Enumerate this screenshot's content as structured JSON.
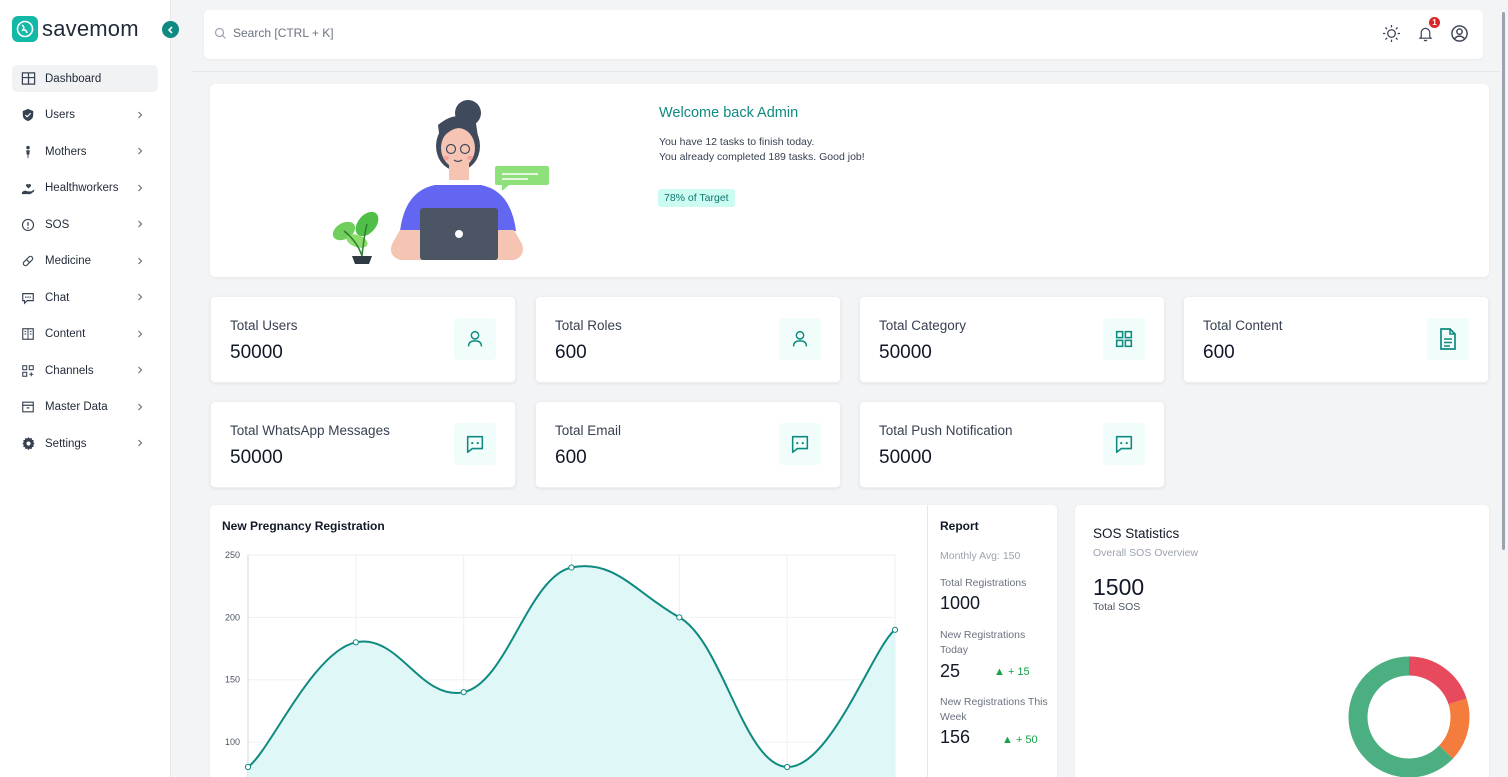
{
  "brand": {
    "name": "savemom"
  },
  "sidebar": {
    "items": [
      {
        "label": "Dashboard",
        "icon": "dashboard-icon"
      },
      {
        "label": "Users",
        "icon": "shield-icon"
      },
      {
        "label": "Mothers",
        "icon": "person-icon"
      },
      {
        "label": "Healthworkers",
        "icon": "hand-heart-icon"
      },
      {
        "label": "SOS",
        "icon": "alert-icon"
      },
      {
        "label": "Medicine",
        "icon": "pill-icon"
      },
      {
        "label": "Chat",
        "icon": "chat-icon"
      },
      {
        "label": "Content",
        "icon": "book-icon"
      },
      {
        "label": "Channels",
        "icon": "apps-add-icon"
      },
      {
        "label": "Master Data",
        "icon": "archive-icon"
      },
      {
        "label": "Settings",
        "icon": "gear-icon"
      }
    ]
  },
  "topbar": {
    "search_placeholder": "Search [CTRL + K]",
    "notification_count": "1"
  },
  "welcome": {
    "title": "Welcome back Admin",
    "line1": "You have 12 tasks to finish today.",
    "line2": "You already completed 189 tasks. Good job!",
    "target": "78% of Target"
  },
  "stats": [
    {
      "label": "Total Users",
      "value": "50000",
      "icon": "user-icon"
    },
    {
      "label": "Total Roles",
      "value": "600",
      "icon": "user-icon"
    },
    {
      "label": "Total Category",
      "value": "50000",
      "icon": "grid-icon"
    },
    {
      "label": "Total Content",
      "value": "600",
      "icon": "document-icon"
    },
    {
      "label": "Total WhatsApp Messages",
      "value": "50000",
      "icon": "message-icon"
    },
    {
      "label": "Total Email",
      "value": "600",
      "icon": "message-icon"
    },
    {
      "label": "Total Push Notification",
      "value": "50000",
      "icon": "message-icon"
    }
  ],
  "pregnancy": {
    "title": "New Pregnancy Registration"
  },
  "chart_data": {
    "type": "area",
    "title": "New Pregnancy Registration",
    "y_ticks": [
      "250",
      "200",
      "150",
      "100"
    ],
    "x": [
      0,
      1,
      2,
      3,
      4,
      5,
      6
    ],
    "values": [
      80,
      180,
      140,
      240,
      200,
      80,
      190
    ],
    "ylim": [
      80,
      250
    ],
    "grid": true,
    "color": "#0f8a80",
    "fill": "#dff7f7"
  },
  "report": {
    "title": "Report",
    "monthly_avg": "Monthly Avg: 150",
    "total_label": "Total Registrations",
    "total_value": "1000",
    "today_label": "New Registrations Today",
    "today_value": "25",
    "today_delta": "▲ + 15",
    "week_label": "New Registrations This Week",
    "week_value": "156",
    "week_delta": "▲ + 50"
  },
  "sos": {
    "title": "SOS Statistics",
    "subtitle": "Overall SOS Overview",
    "total": "1500",
    "total_label": "Total SOS",
    "segments": [
      {
        "value": 0.2,
        "color": "#e64a5c"
      },
      {
        "value": 0.17,
        "color": "#f47c3c"
      },
      {
        "value": 0.63,
        "color": "#4caf82"
      }
    ]
  }
}
